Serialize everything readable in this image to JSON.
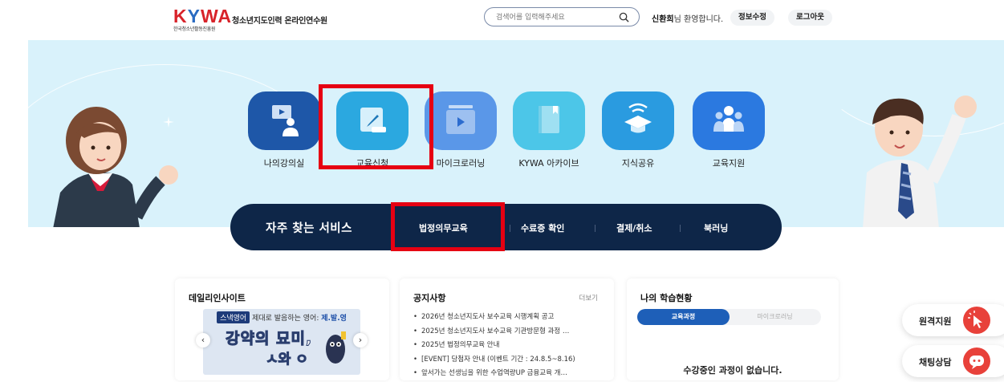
{
  "header": {
    "logo_mark": "KYWA",
    "logo_sub": "한국청소년활동진흥원",
    "site_name": "청소년지도인력 온라인연수원",
    "search_placeholder": "검색어를 입력해주세요",
    "welcome_name": "신환희",
    "welcome_suffix": "님 환영합니다.",
    "edit_info": "정보수정",
    "logout": "로그아웃"
  },
  "main_menu": [
    {
      "label": "나의강의실",
      "icon": "lecture-monitor-icon",
      "color": "#1e57a8"
    },
    {
      "label": "교육신청",
      "icon": "edit-pencil-icon",
      "color": "#2ba8e0"
    },
    {
      "label": "마이크로러닝",
      "icon": "video-folder-icon",
      "color": "#5a97e8"
    },
    {
      "label": "KYWA 아카이브",
      "icon": "book-icon",
      "color": "#4cc6e8"
    },
    {
      "label": "지식공유",
      "icon": "graduation-cap-icon",
      "color": "#2a9be0"
    },
    {
      "label": "교육지원",
      "icon": "people-icon",
      "color": "#2b79e0"
    }
  ],
  "quick_service": {
    "title": "자주 찾는 서비스",
    "items": [
      "법정의무교육",
      "수료증 확인",
      "결제/취소",
      "북러닝"
    ]
  },
  "daily_insight": {
    "title": "데일리인사이트",
    "banner_tag": "스낵영어",
    "banner_line": "제대로 발음하는 영어:",
    "banner_em": "제.발.영",
    "banner_big1": "강약의 묘미,",
    "banner_big2": "ㅅ와 ㅇ"
  },
  "notice": {
    "title": "공지사항",
    "more": "더보기",
    "items": [
      "2026년 청소년지도사 보수교육 시행계획 공고",
      "2025년 청소년지도사 보수교육 기관방문형 과정 …",
      "2025년 법정의무교육 안내",
      "[EVENT] 당첨자 안내 (이벤트 기간 : 24.8.5~8.16)",
      "앞서가는 선생님을 위한 수업역량UP 금융교육 개…"
    ]
  },
  "my_learning": {
    "title": "나의 학습현황",
    "tab_course": "교육과정",
    "tab_micro": "마이크로러닝",
    "empty": "수강중인 과정이 없습니다."
  },
  "floating": {
    "remote": "원격지원",
    "chat": "채팅상담"
  }
}
